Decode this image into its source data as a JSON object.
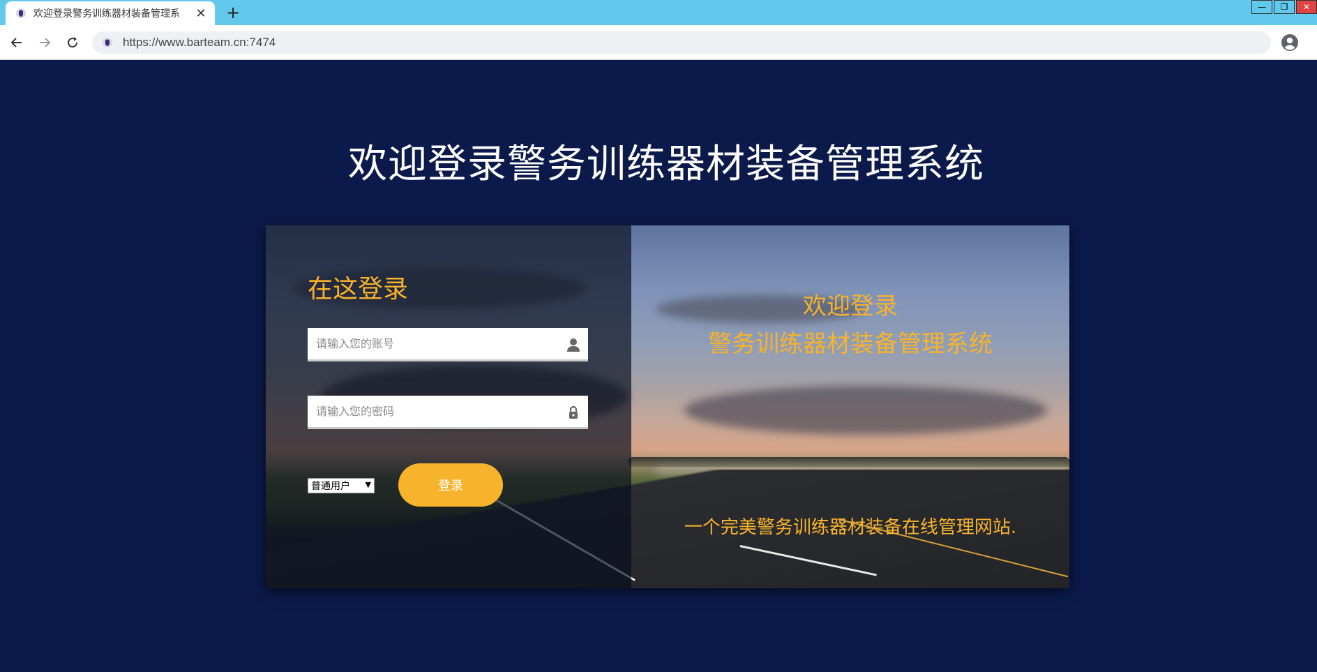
{
  "browser": {
    "tab_title": "欢迎登录警务训练器材装备管理系",
    "tab_close": "✕",
    "new_tab": "+",
    "url": "https://www.barteam.cn:7474",
    "window_buttons": {
      "minimize": "—",
      "restore": "❐",
      "close": "✕"
    }
  },
  "page": {
    "title": "欢迎登录警务训练器材装备管理系统"
  },
  "login": {
    "heading": "在这登录",
    "account_placeholder": "请输入您的账号",
    "password_placeholder": "请输入您的密码",
    "role_selected": "普通用户",
    "login_button": "登录"
  },
  "welcome": {
    "line1": "欢迎登录",
    "line2": "警务训练器材装备管理系统",
    "tagline": "一个完美警务训练器材装备在线管理网站."
  },
  "colors": {
    "accent": "#f7b32c",
    "page_bg": "#0b1a4a",
    "tabbar": "#62c8ec"
  },
  "icons": {
    "account": "user-icon",
    "password": "lock-icon",
    "back": "back-arrow-icon",
    "forward": "forward-arrow-icon",
    "reload": "reload-icon",
    "profile": "profile-icon"
  }
}
